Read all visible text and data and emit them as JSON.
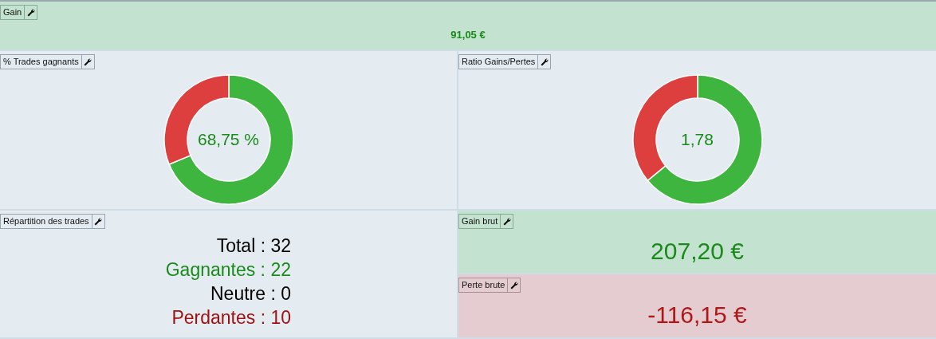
{
  "gain": {
    "title": "Gain",
    "value": "91,05 €"
  },
  "win_rate": {
    "title": "% Trades gagnants",
    "label": "68,75 %",
    "chart_data": {
      "type": "donut",
      "series": [
        {
          "values": [
            68.75,
            31.25
          ]
        }
      ],
      "colors": [
        "#3eb53e",
        "#dd3e3e"
      ]
    }
  },
  "ratio": {
    "title": "Ratio Gains/Pertes",
    "label": "1,78",
    "chart_data": {
      "type": "donut",
      "series": [
        {
          "values": [
            64.08,
            35.92
          ]
        }
      ],
      "colors": [
        "#3eb53e",
        "#dd3e3e"
      ]
    }
  },
  "distribution": {
    "title": "Répartition des trades",
    "lines": [
      {
        "text": "Total : 32",
        "kind": "neutral"
      },
      {
        "text": "Gagnantes : 22",
        "kind": "win"
      },
      {
        "text": "Neutre : 0",
        "kind": "neutral"
      },
      {
        "text": "Perdantes : 10",
        "kind": "loss"
      }
    ]
  },
  "gross_gain": {
    "title": "Gain brut",
    "value": "207,20 €"
  },
  "gross_loss": {
    "title": "Perte brute",
    "value": "-116,15 €"
  }
}
